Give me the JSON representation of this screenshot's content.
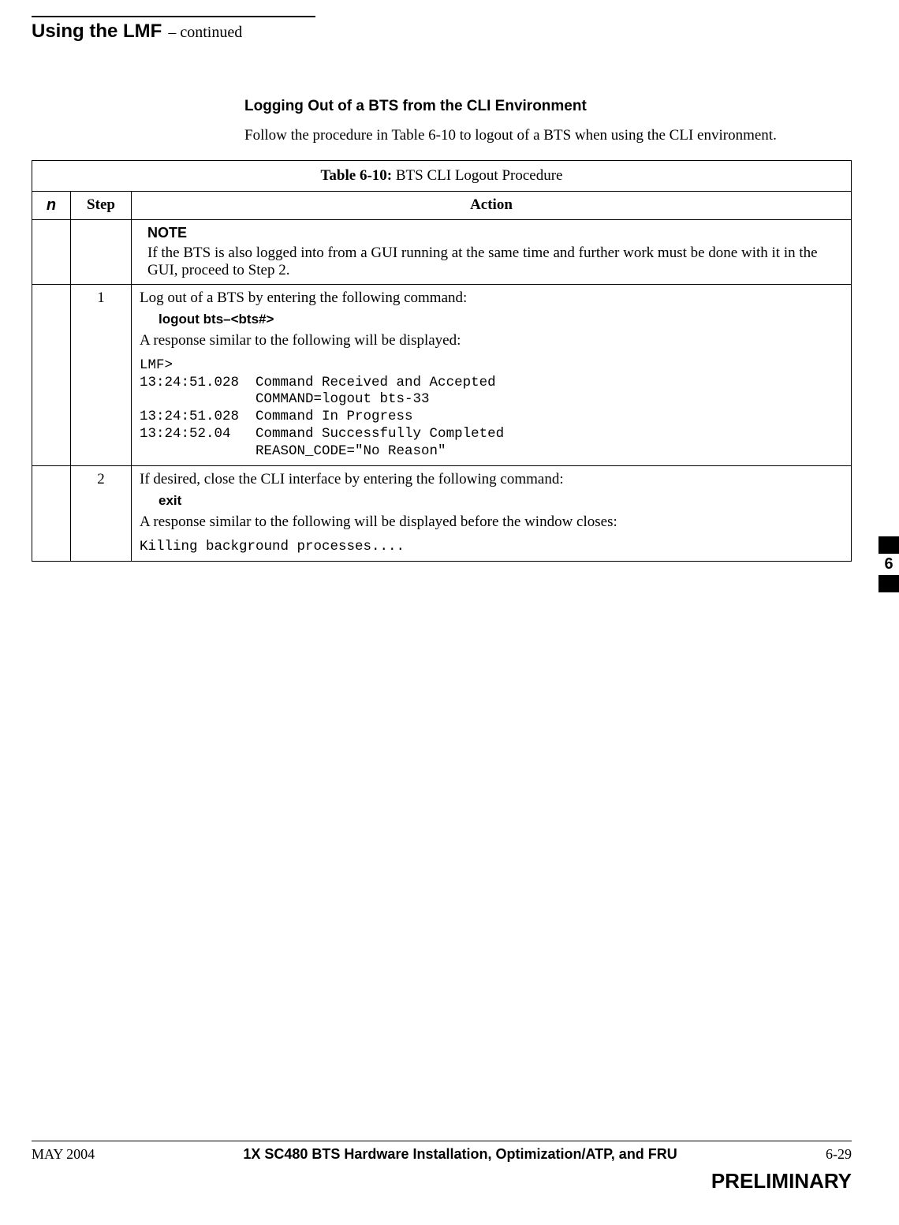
{
  "header": {
    "title": "Using the LMF",
    "continued": " – continued"
  },
  "section": {
    "heading": "Logging Out of a BTS from the CLI Environment",
    "intro": "Follow the procedure in Table 6-10 to logout of a BTS when using the CLI environment."
  },
  "table": {
    "label": "Table 6-10:",
    "caption": " BTS CLI Logout Procedure",
    "head_check": "n",
    "head_step": "Step",
    "head_action": "Action",
    "note_label": "NOTE",
    "note_text": "If the BTS is also logged into from a GUI running at the same time and further work must be done with it in the GUI, proceed to Step 2.",
    "rows": [
      {
        "step": "1",
        "line1": "Log out of a BTS by entering the following command:",
        "cmd": "logout bts–<bts#>",
        "line2": "A response similar to the following will be displayed:",
        "mono": "LMF>\n13:24:51.028  Command Received and Accepted\n              COMMAND=logout bts-33\n13:24:51.028  Command In Progress\n13:24:52.04   Command Successfully Completed\n              REASON_CODE=\"No Reason\""
      },
      {
        "step": "2",
        "line1": "If desired, close the CLI interface by entering the following command:",
        "cmd": "exit",
        "line2": "A response similar to the following will be displayed before the window closes:",
        "mono": "Killing background processes...."
      }
    ]
  },
  "thumb": {
    "num": "6"
  },
  "footer": {
    "left": "MAY 2004",
    "center": "1X SC480 BTS Hardware Installation, Optimization/ATP, and FRU",
    "right": "6-29",
    "prelim": "PRELIMINARY"
  }
}
